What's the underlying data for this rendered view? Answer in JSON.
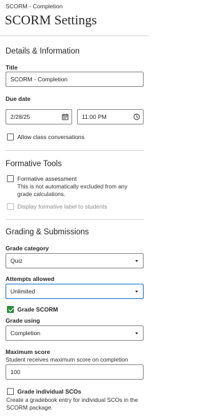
{
  "header": {
    "breadcrumb": "SCORM - Completion",
    "title": "SCORM Settings"
  },
  "details": {
    "heading": "Details & Information",
    "title_label": "Title",
    "title_value": "SCORM - Completion",
    "due_date_label": "Due date",
    "date_value": "2/28/25",
    "time_value": "11:00 PM",
    "allow_conversations_label": "Allow class conversations"
  },
  "formative": {
    "heading": "Formative Tools",
    "assessment_label": "Formative assessment",
    "assessment_hint": "This is not automatically excluded from any grade calculations.",
    "display_label": "Display formative label to students"
  },
  "grading": {
    "heading": "Grading & Submissions",
    "category_label": "Grade category",
    "category_value": "Quiz",
    "attempts_label": "Attempts allowed",
    "attempts_value": "Unlimited",
    "grade_scorm_label": "Grade SCORM",
    "grade_using_label": "Grade using",
    "grade_using_value": "Completion",
    "max_score_label": "Maximum score",
    "max_score_hint": "Student receives maximum score on completion",
    "max_score_value": "100",
    "individual_scos_label": "Grade individual SCOs",
    "individual_scos_hint": "Create a gradebook entry for individual SCOs in the SCORM package."
  },
  "icons": {
    "calendar": "calendar-icon",
    "clock": "clock-icon",
    "dropdown": "chevron-down-icon",
    "check": "checkmark-icon"
  },
  "colors": {
    "accent_focus": "#1d72c9",
    "checkbox_checked": "#2f8f3a",
    "divider": "#d9d9d9"
  }
}
